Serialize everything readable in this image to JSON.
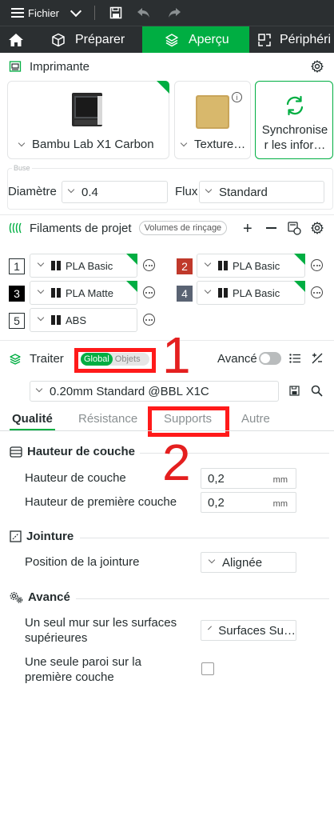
{
  "menubar": {
    "file_label": "Fichier"
  },
  "tabs": [
    {
      "label": "Préparer"
    },
    {
      "label": "Aperçu"
    },
    {
      "label": "Périphéri"
    }
  ],
  "printer": {
    "title": "Imprimante",
    "printer_name": "Bambu Lab X1 Carbon",
    "plate_name": "Texture…",
    "sync_label_line1": "Synchronise",
    "sync_label_line2": "r les infor…",
    "nozzle_label": "Buse",
    "diameter_label": "Diamètre",
    "diameter_value": "0.4",
    "flow_label": "Flux",
    "flow_value": "Standard"
  },
  "filaments": {
    "title": "Filaments de projet",
    "flush_label": "Volumes de rinçage",
    "items": [
      {
        "num": "1",
        "name": "PLA Basic"
      },
      {
        "num": "2",
        "name": "PLA Basic"
      },
      {
        "num": "3",
        "name": "PLA Matte"
      },
      {
        "num": "4",
        "name": "PLA Basic"
      },
      {
        "num": "5",
        "name": "ABS"
      }
    ]
  },
  "process": {
    "title": "Traiter",
    "global_label": "Global",
    "objects_label": "Objets",
    "advanced_label": "Avancé",
    "preset": "0.20mm Standard @BBL X1C",
    "subtabs": [
      "Qualité",
      "Résistance",
      "Supports",
      "Autre"
    ]
  },
  "annotations": {
    "one": "1",
    "two": "2"
  },
  "quality": {
    "layer_group": "Hauteur de couche",
    "layer_height_label": "Hauteur de couche",
    "layer_height_value": "0,2",
    "first_layer_label": "Hauteur de première couche",
    "first_layer_value": "0,2",
    "unit": "mm",
    "seam_group": "Jointure",
    "seam_label": "Position de la jointure",
    "seam_value": "Alignée",
    "adv_group": "Avancé",
    "single_wall_top_line1": "Un seul mur sur les surfaces",
    "single_wall_top_line2": "supérieures",
    "single_wall_top_value": "Surfaces Su…",
    "single_wall_first_line1": "Une seule paroi sur la",
    "single_wall_first_line2": "première couche"
  },
  "colors": {
    "accent": "#00ae42",
    "annotation_red": "#ff1a1a",
    "toolbar_bg": "#2b2f31"
  }
}
